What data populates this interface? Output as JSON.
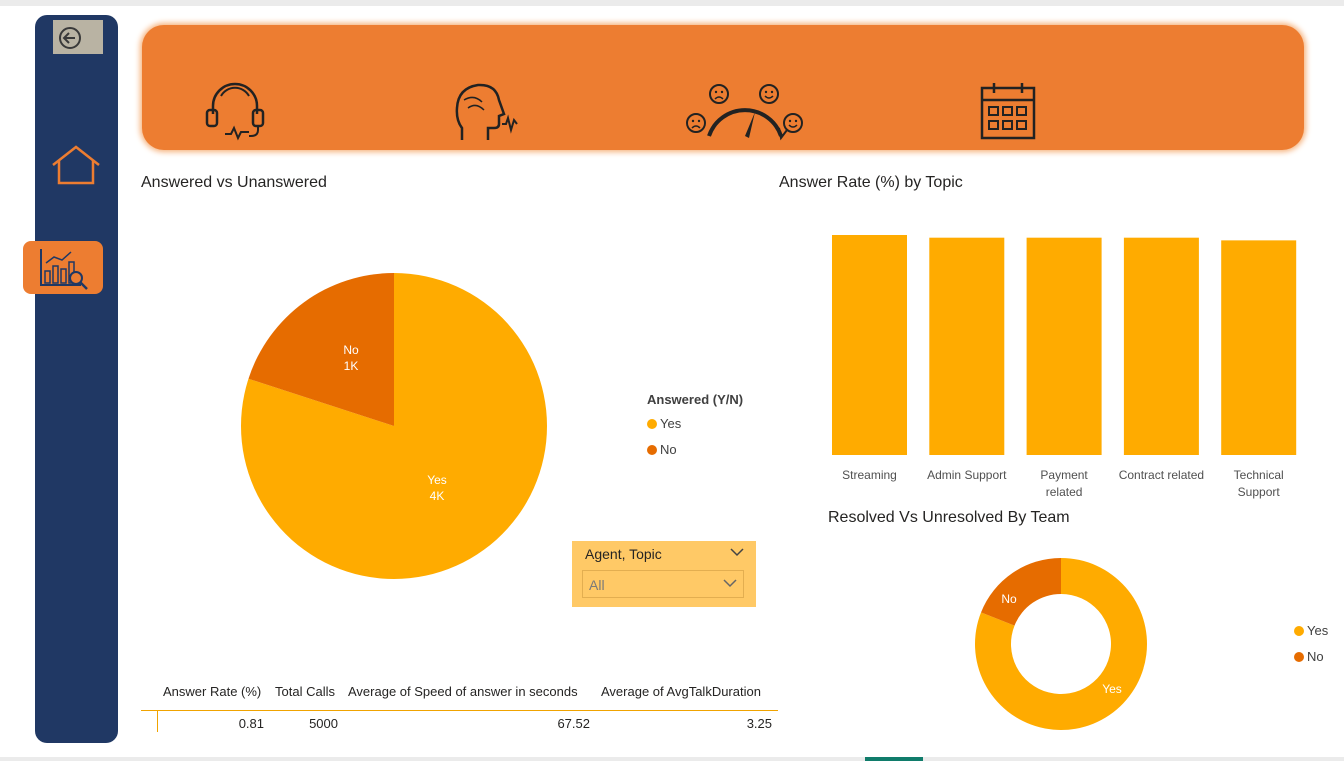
{
  "nav": {
    "back_icon": "back-arrow-icon",
    "home_icon": "home-icon",
    "analytics_icon": "analytics-chart-icon"
  },
  "banner": {
    "icons": [
      "headset-agent-icon",
      "speaking-person-icon",
      "satisfaction-gauge-icon",
      "calendar-icon"
    ]
  },
  "colors": {
    "yes": "#ffab00",
    "no": "#e66c00",
    "banner": "#ed7d31",
    "sidebar": "#203864",
    "slicer": "#ffc966"
  },
  "answered_chart": {
    "title": "Answered vs Unanswered",
    "legend_title": "Answered (Y/N)",
    "legend": [
      "Yes",
      "No"
    ],
    "slices": [
      {
        "label": "Yes",
        "value_label": "4K"
      },
      {
        "label": "No",
        "value_label": "1K"
      }
    ]
  },
  "answer_rate_chart": {
    "title": "Answer Rate (%) by Topic"
  },
  "resolved_chart": {
    "title": "Resolved Vs Unresolved By Team",
    "legend": [
      "Yes",
      "No"
    ],
    "labels": [
      "No",
      "Yes"
    ]
  },
  "slicer": {
    "title": "Agent, Topic",
    "value": "All"
  },
  "table": {
    "headers": [
      "Answer Rate (%)",
      "Total Calls",
      "Average of Speed of answer in seconds",
      "Average of AvgTalkDuration"
    ],
    "row": [
      "0.81",
      "5000",
      "67.52",
      "3.25"
    ]
  },
  "chart_data": [
    {
      "type": "pie",
      "title": "Answered vs Unanswered",
      "categories": [
        "Yes",
        "No"
      ],
      "values": [
        4000,
        1000
      ],
      "legend_title": "Answered (Y/N)"
    },
    {
      "type": "bar",
      "title": "Answer Rate (%) by Topic",
      "categories": [
        "Streaming",
        "Admin Support",
        "Payment related",
        "Contract related",
        "Technical Support"
      ],
      "values": [
        0.82,
        0.81,
        0.81,
        0.81,
        0.8
      ],
      "ylim": [
        0,
        0.82
      ]
    },
    {
      "type": "pie",
      "title": "Resolved Vs Unresolved By Team",
      "categories": [
        "Yes",
        "No"
      ],
      "values": [
        0.81,
        0.19
      ]
    }
  ]
}
